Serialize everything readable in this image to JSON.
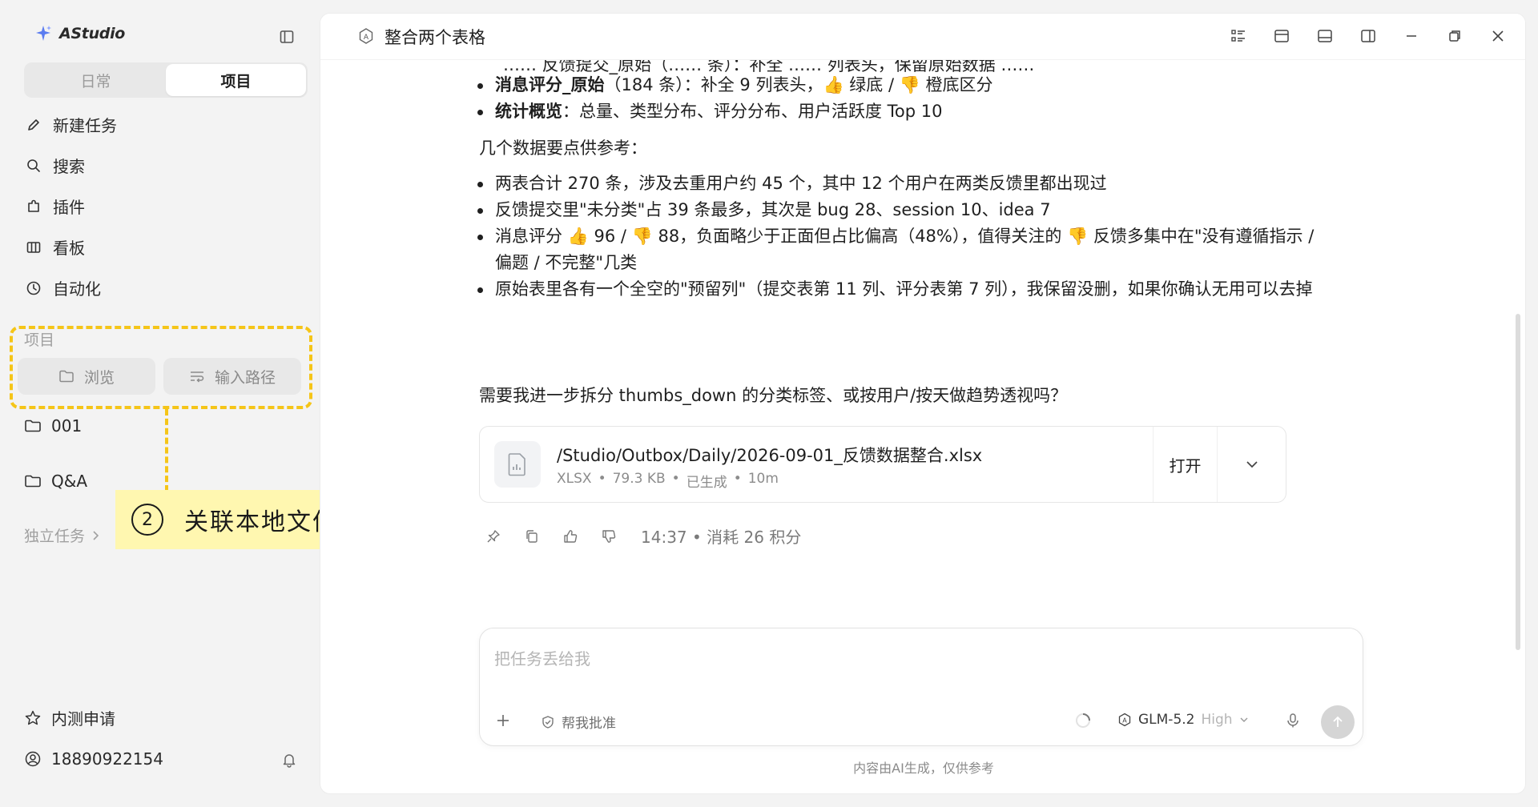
{
  "app": {
    "name": "AStudio"
  },
  "sidebar": {
    "tabs": [
      {
        "label": "日常",
        "active": false
      },
      {
        "label": "项目",
        "active": true
      }
    ],
    "nav": [
      {
        "label": "新建任务",
        "icon": "pencil-icon"
      },
      {
        "label": "搜索",
        "icon": "search-icon"
      },
      {
        "label": "插件",
        "icon": "plugin-icon"
      },
      {
        "label": "看板",
        "icon": "board-icon"
      },
      {
        "label": "自动化",
        "icon": "clock-icon"
      }
    ],
    "projects_label": "项目",
    "browse_label": "浏览",
    "path_label": "输入路径",
    "folders": [
      "001",
      "Q&A"
    ],
    "independent_label": "独立任务",
    "beta_label": "内测申请",
    "user_phone": "18890922154"
  },
  "callout": {
    "number": "2",
    "text": "关联本地文件夹",
    "color": "#f5c518",
    "background": "#fff7b0"
  },
  "header": {
    "title": "整合两个表格"
  },
  "message": {
    "cut_line": "…… 反馈提交_原始（…… 条）：补全 …… 列表头，保留原始数据 ……",
    "top_bullets": [
      {
        "bold": "消息评分_原始",
        "text": "（184 条）：补全 9 列表头，👍 绿底 / 👎 橙底区分"
      },
      {
        "bold": "统计概览",
        "text": "：总量、类型分布、评分分布、用户活跃度 Top 10"
      }
    ],
    "intro": "几个数据要点供参考：",
    "points": [
      "两表合计 270 条，涉及去重用户约 45 个，其中 12 个用户在两类反馈里都出现过",
      "反馈提交里\"未分类\"占 39 条最多，其次是 bug 28、session 10、idea 7",
      "消息评分 👍 96 / 👎 88，负面略少于正面但占比偏高（48%），值得关注的 👎 反馈多集中在\"没有遵循指示 / 偏题 / 不完整\"几类",
      "原始表里各有一个全空的\"预留列\"（提交表第 11 列、评分表第 7 列），我保留没删，如果你确认无用可以去掉"
    ],
    "question": "需要我进一步拆分 thumbs_down 的分类标签、或按用户/按天做趋势透视吗？",
    "file": {
      "path": "/Studio/Outbox/Daily/2026-09-01_反馈数据整合.xlsx",
      "type": "XLSX",
      "size": "79.3 KB",
      "status": "已生成",
      "age": "10m",
      "open_label": "打开"
    },
    "time": "14:37",
    "cost": "消耗 26 积分"
  },
  "composer": {
    "placeholder": "把任务丢给我",
    "review_label": "帮我批准",
    "model": "GLM-5.2",
    "level": "High"
  },
  "disclaimer": "内容由AI生成，仅供参考"
}
